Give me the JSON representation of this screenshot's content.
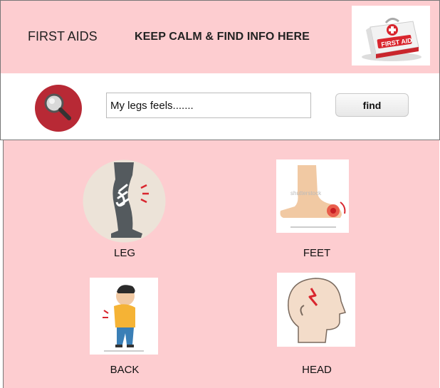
{
  "header": {
    "app_title": "FIRST AIDS",
    "tagline": "KEEP CALM & FIND INFO HERE",
    "logo_text": "FIRST AID"
  },
  "search": {
    "input_value": "My legs feels.......",
    "find_label": "find",
    "icon": "magnifier-icon"
  },
  "body_parts": [
    {
      "label": "LEG",
      "icon": "leg-injury-icon"
    },
    {
      "label": "FEET",
      "icon": "foot-pain-icon"
    },
    {
      "label": "BACK",
      "icon": "back-pain-icon"
    },
    {
      "label": "HEAD",
      "icon": "headache-icon"
    }
  ],
  "colors": {
    "background": "#fdcdd0",
    "accent_red": "#b82935"
  }
}
